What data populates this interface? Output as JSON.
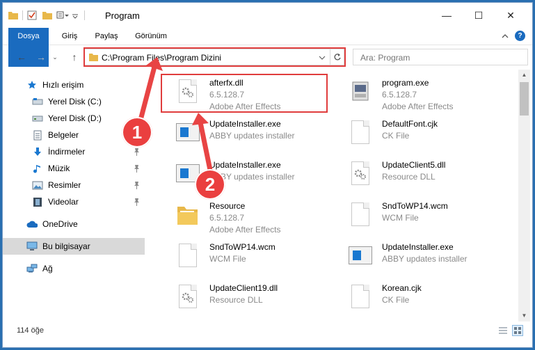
{
  "window": {
    "title": "Program",
    "minimize_glyph": "—",
    "maximize_glyph": "☐",
    "close_glyph": "✕"
  },
  "ribbon": {
    "tabs": [
      "Dosya",
      "Giriş",
      "Paylaş",
      "Görünüm"
    ]
  },
  "address": {
    "path": "C:\\Program Files\\Program Dizini"
  },
  "search": {
    "placeholder": "Ara: Program"
  },
  "nav": {
    "items": [
      {
        "label": "Hızlı erişim",
        "icon": "star-icon"
      },
      {
        "label": "Yerel Disk (C:)",
        "icon": "drive-icon"
      },
      {
        "label": "Yerel Disk (D:)",
        "icon": "drive-icon"
      },
      {
        "label": "Belgeler",
        "icon": "documents-icon"
      },
      {
        "label": "İndirmeler",
        "icon": "download-icon"
      },
      {
        "label": "Müzik",
        "icon": "music-icon"
      },
      {
        "label": "Resimler",
        "icon": "pictures-icon"
      },
      {
        "label": "Videolar",
        "icon": "video-icon"
      },
      {
        "label": "OneDrive",
        "icon": "cloud-icon"
      },
      {
        "label": "Bu bilgisayar",
        "icon": "computer-icon"
      },
      {
        "label": "Ağ",
        "icon": "network-icon"
      }
    ]
  },
  "files": [
    {
      "name": "afterfx.dll",
      "l2": "6.5.128.7",
      "l3": "Adobe After Effects",
      "icon": "dll-gear-icon"
    },
    {
      "name": "program.exe",
      "l2": "6.5.128.7",
      "l3": "Adobe After Effects",
      "icon": "exe-icon"
    },
    {
      "name": "UpdateInstaller.exe",
      "l2": "ABBY updates installer",
      "l3": "",
      "icon": "installer-icon"
    },
    {
      "name": "DefaultFont.cjk",
      "l2": "CK File",
      "l3": "",
      "icon": "file-icon"
    },
    {
      "name": "UpdateInstaller.exe",
      "l2": "ABBY updates installer",
      "l3": "",
      "icon": "installer-icon"
    },
    {
      "name": "UpdateClient5.dll",
      "l2": "Resource DLL",
      "l3": "",
      "icon": "dll-gear-icon"
    },
    {
      "name": "Resource",
      "l2": "6.5.128.7",
      "l3": "Adobe After Effects",
      "icon": "folder-icon"
    },
    {
      "name": "SndToWP14.wcm",
      "l2": "WCM File",
      "l3": "",
      "icon": "file-icon"
    },
    {
      "name": "SndToWP14.wcm",
      "l2": "WCM File",
      "l3": "",
      "icon": "file-icon"
    },
    {
      "name": "UpdateInstaller.exe",
      "l2": "ABBY updates installer",
      "l3": "",
      "icon": "installer-icon"
    },
    {
      "name": "UpdateClient19.dll",
      "l2": "Resource DLL",
      "l3": "",
      "icon": "dll-gear-icon"
    },
    {
      "name": "Korean.cjk",
      "l2": "CK File",
      "l3": "",
      "icon": "file-icon"
    }
  ],
  "status": {
    "count": "114 öğe"
  },
  "annotations": [
    "1",
    "2"
  ],
  "colors": {
    "accent": "#1a6bbf",
    "highlight": "#e03c3c",
    "arrow": "#e84444"
  }
}
